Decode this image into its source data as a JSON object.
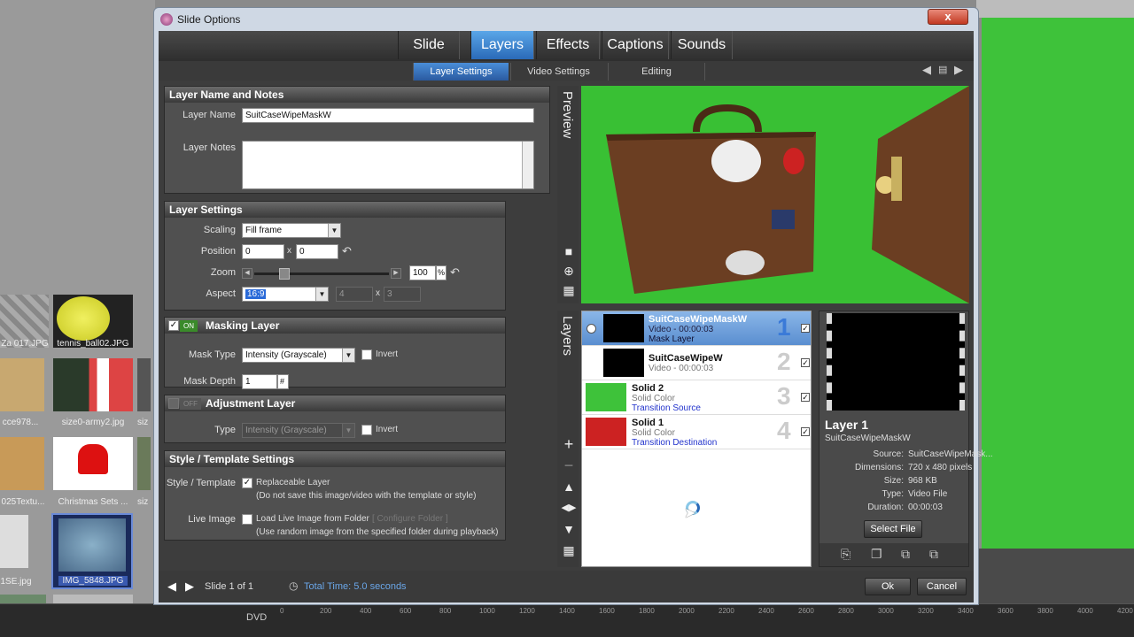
{
  "window": {
    "title": "Slide Options",
    "close_label": "x"
  },
  "main_tabs": [
    {
      "label": "Slide"
    },
    {
      "label": "Layers"
    },
    {
      "label": "Effects"
    },
    {
      "label": "Captions"
    },
    {
      "label": "Sounds"
    }
  ],
  "sub_tabs": [
    {
      "label": "Layer Settings"
    },
    {
      "label": "Video Settings"
    },
    {
      "label": "Editing"
    }
  ],
  "layer_name_notes": {
    "header": "Layer Name and Notes",
    "name_label": "Layer Name",
    "name_value": "SuitCaseWipeMaskW",
    "notes_label": "Layer Notes",
    "notes_value": ""
  },
  "layer_settings": {
    "header": "Layer Settings",
    "scaling_label": "Scaling",
    "scaling_value": "Fill frame",
    "position_label": "Position",
    "position_x": "0",
    "position_y": "0",
    "x_sep": "x",
    "zoom_label": "Zoom",
    "zoom_value": "100",
    "zoom_unit": "%",
    "zoom_fraction": 0.2,
    "aspect_label": "Aspect",
    "aspect_value": "16:9",
    "aspect_w": "4",
    "aspect_h": "3"
  },
  "masking": {
    "header": "Masking Layer",
    "toggle": "ON",
    "mask_type_label": "Mask Type",
    "mask_type_value": "Intensity (Grayscale)",
    "invert_label": "Invert",
    "mask_depth_label": "Mask Depth",
    "mask_depth_value": "1",
    "depth_hash": "#"
  },
  "adjustment": {
    "header": "Adjustment Layer",
    "toggle": "OFF",
    "type_label": "Type",
    "type_value": "Intensity (Grayscale)",
    "invert_label": "Invert"
  },
  "style_template": {
    "header": "Style / Template Settings",
    "style_label": "Style / Template",
    "replaceable_label": "Replaceable Layer",
    "replaceable_note": "(Do not save this image/video with the template or style)",
    "live_label": "Live Image",
    "live_option": "Load Live Image from Folder",
    "configure": "[ Configure Folder ]",
    "live_note": "(Use random image from the specified folder during playback)"
  },
  "side_labels": {
    "preview": "Preview",
    "layers": "Layers"
  },
  "layers": [
    {
      "name": "SuitCaseWipeMaskW",
      "sub": "Video - 00:00:03",
      "link": "Mask Layer",
      "num": "1"
    },
    {
      "name": "SuitCaseWipeW",
      "sub": "Video - 00:00:03",
      "link": "",
      "num": "2"
    },
    {
      "name": "Solid 2",
      "sub": "Solid Color",
      "link": "Transition Source",
      "num": "3"
    },
    {
      "name": "Solid 1",
      "sub": "Solid Color",
      "link": "Transition Destination",
      "num": "4"
    }
  ],
  "info": {
    "title": "Layer 1",
    "subtitle": "SuitCaseWipeMaskW",
    "rows": [
      {
        "k": "Source:",
        "v": "SuitCaseWipeMask..."
      },
      {
        "k": "Dimensions:",
        "v": "720 x 480 pixels"
      },
      {
        "k": "Size:",
        "v": "968 KB"
      },
      {
        "k": "Type:",
        "v": "Video File"
      },
      {
        "k": "Duration:",
        "v": "00:00:03"
      }
    ],
    "select_file": "Select File"
  },
  "footer": {
    "slide_label": "Slide 1 of 1",
    "total_time": "Total Time: 5.0 seconds",
    "ok": "Ok",
    "cancel": "Cancel"
  },
  "background_files": [
    {
      "name": "Za 017.JPG"
    },
    {
      "name": "tennis_ball02.JPG"
    },
    {
      "name": "cce978..."
    },
    {
      "name": "size0-army2.jpg"
    },
    {
      "name": "siz"
    },
    {
      "name": "025Textu..."
    },
    {
      "name": "Christmas Sets ..."
    },
    {
      "name": "siz"
    },
    {
      "name": "1SE.jpg"
    },
    {
      "name": "IMG_5848.JPG"
    }
  ],
  "timeline": {
    "track": "DVD",
    "ticks": [
      "0",
      "200",
      "400",
      "600",
      "800",
      "1000",
      "1200",
      "1400",
      "1600",
      "1800",
      "2000",
      "2200",
      "2400",
      "2600",
      "2800",
      "3000",
      "3200",
      "3400",
      "3600",
      "3800",
      "4000",
      "4200"
    ]
  },
  "colors": {
    "accent": "#3a7ad8",
    "green_screen": "#3ec23a",
    "solid2": "#3ec23a",
    "solid1": "#cc2222"
  }
}
